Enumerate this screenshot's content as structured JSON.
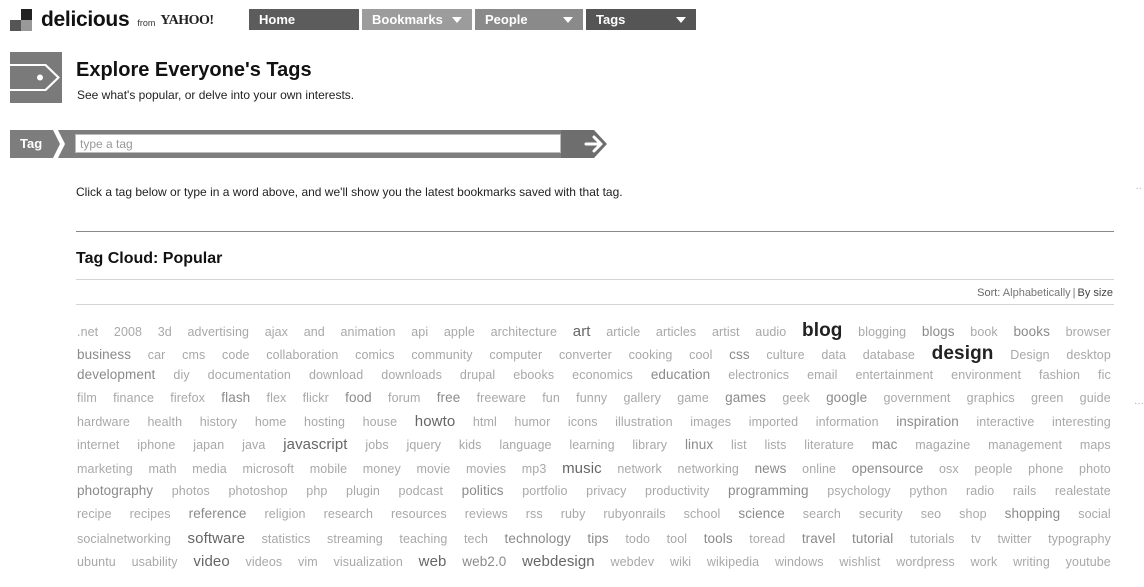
{
  "brand": {
    "name": "delicious",
    "from": "from",
    "yahoo": "YAHOO!"
  },
  "nav": {
    "home": "Home",
    "bookmarks": "Bookmarks",
    "people": "People",
    "tags": "Tags"
  },
  "header": {
    "title": "Explore Everyone's Tags",
    "subtitle": "See what's popular, or delve into your own interests."
  },
  "search": {
    "label": "Tag",
    "placeholder": "type a tag"
  },
  "instructions": "Click a tag below or type in a word above, and we'll show you the latest bookmarks saved with that tag.",
  "cloud": {
    "title": "Tag Cloud: Popular",
    "sort_label": "Sort:",
    "sort_alpha": "Alphabetically",
    "sort_separator": "|",
    "sort_size": "By size",
    "rows": [
      [
        [
          ".net",
          1
        ],
        [
          "2008",
          1
        ],
        [
          "3d",
          1
        ],
        [
          "advertising",
          1
        ],
        [
          "ajax",
          1
        ],
        [
          "and",
          1
        ],
        [
          "animation",
          1
        ],
        [
          "api",
          1
        ],
        [
          "apple",
          1
        ],
        [
          "architecture",
          1
        ],
        [
          "art",
          3
        ],
        [
          "article",
          1
        ],
        [
          "articles",
          1
        ],
        [
          "artist",
          1
        ],
        [
          "audio",
          1
        ],
        [
          "blog",
          5
        ],
        [
          "blogging",
          1
        ],
        [
          "blogs",
          2
        ],
        [
          "book",
          1
        ],
        [
          "books",
          2
        ],
        [
          "browser",
          1
        ]
      ],
      [
        [
          "business",
          2
        ],
        [
          "car",
          1
        ],
        [
          "cms",
          1
        ],
        [
          "code",
          1
        ],
        [
          "collaboration",
          1
        ],
        [
          "comics",
          1
        ],
        [
          "community",
          1
        ],
        [
          "computer",
          1
        ],
        [
          "converter",
          1
        ],
        [
          "cooking",
          1
        ],
        [
          "cool",
          1
        ],
        [
          "css",
          2
        ],
        [
          "culture",
          1
        ],
        [
          "data",
          1
        ],
        [
          "database",
          1
        ],
        [
          "design",
          5
        ],
        [
          "Design",
          1
        ],
        [
          "desktop",
          1
        ]
      ],
      [
        [
          "development",
          2
        ],
        [
          "diy",
          1
        ],
        [
          "documentation",
          1
        ],
        [
          "download",
          1
        ],
        [
          "downloads",
          1
        ],
        [
          "drupal",
          1
        ],
        [
          "ebooks",
          1
        ],
        [
          "economics",
          1
        ],
        [
          "education",
          2
        ],
        [
          "electronics",
          1
        ],
        [
          "email",
          1
        ],
        [
          "entertainment",
          1
        ],
        [
          "environment",
          1
        ],
        [
          "fashion",
          1
        ],
        [
          "fic",
          1
        ]
      ],
      [
        [
          "film",
          1
        ],
        [
          "finance",
          1
        ],
        [
          "firefox",
          1
        ],
        [
          "flash",
          2
        ],
        [
          "flex",
          1
        ],
        [
          "flickr",
          1
        ],
        [
          "food",
          2
        ],
        [
          "forum",
          1
        ],
        [
          "free",
          2
        ],
        [
          "freeware",
          1
        ],
        [
          "fun",
          1
        ],
        [
          "funny",
          1
        ],
        [
          "gallery",
          1
        ],
        [
          "game",
          1
        ],
        [
          "games",
          2
        ],
        [
          "geek",
          1
        ],
        [
          "google",
          2
        ],
        [
          "government",
          1
        ],
        [
          "graphics",
          1
        ],
        [
          "green",
          1
        ],
        [
          "guide",
          1
        ]
      ],
      [
        [
          "hardware",
          1
        ],
        [
          "health",
          1
        ],
        [
          "history",
          1
        ],
        [
          "home",
          1
        ],
        [
          "hosting",
          1
        ],
        [
          "house",
          1
        ],
        [
          "howto",
          3
        ],
        [
          "html",
          1
        ],
        [
          "humor",
          1
        ],
        [
          "icons",
          1
        ],
        [
          "illustration",
          1
        ],
        [
          "images",
          1
        ],
        [
          "imported",
          1
        ],
        [
          "information",
          1
        ],
        [
          "inspiration",
          2
        ],
        [
          "interactive",
          1
        ],
        [
          "interesting",
          1
        ]
      ],
      [
        [
          "internet",
          1
        ],
        [
          "iphone",
          1
        ],
        [
          "japan",
          1
        ],
        [
          "java",
          1
        ],
        [
          "javascript",
          3
        ],
        [
          "jobs",
          1
        ],
        [
          "jquery",
          1
        ],
        [
          "kids",
          1
        ],
        [
          "language",
          1
        ],
        [
          "learning",
          1
        ],
        [
          "library",
          1
        ],
        [
          "linux",
          2
        ],
        [
          "list",
          1
        ],
        [
          "lists",
          1
        ],
        [
          "literature",
          1
        ],
        [
          "mac",
          2
        ],
        [
          "magazine",
          1
        ],
        [
          "management",
          1
        ],
        [
          "maps",
          1
        ]
      ],
      [
        [
          "marketing",
          1
        ],
        [
          "math",
          1
        ],
        [
          "media",
          1
        ],
        [
          "microsoft",
          1
        ],
        [
          "mobile",
          1
        ],
        [
          "money",
          1
        ],
        [
          "movie",
          1
        ],
        [
          "movies",
          1
        ],
        [
          "mp3",
          1
        ],
        [
          "music",
          3
        ],
        [
          "network",
          1
        ],
        [
          "networking",
          1
        ],
        [
          "news",
          2
        ],
        [
          "online",
          1
        ],
        [
          "opensource",
          2
        ],
        [
          "osx",
          1
        ],
        [
          "people",
          1
        ],
        [
          "phone",
          1
        ],
        [
          "photo",
          1
        ]
      ],
      [
        [
          "photography",
          2
        ],
        [
          "photos",
          1
        ],
        [
          "photoshop",
          1
        ],
        [
          "php",
          1
        ],
        [
          "plugin",
          1
        ],
        [
          "podcast",
          1
        ],
        [
          "politics",
          2
        ],
        [
          "portfolio",
          1
        ],
        [
          "privacy",
          1
        ],
        [
          "productivity",
          1
        ],
        [
          "programming",
          2
        ],
        [
          "psychology",
          1
        ],
        [
          "python",
          1
        ],
        [
          "radio",
          1
        ],
        [
          "rails",
          1
        ],
        [
          "realestate",
          1
        ]
      ],
      [
        [
          "recipe",
          1
        ],
        [
          "recipes",
          1
        ],
        [
          "reference",
          2
        ],
        [
          "religion",
          1
        ],
        [
          "research",
          1
        ],
        [
          "resources",
          1
        ],
        [
          "reviews",
          1
        ],
        [
          "rss",
          1
        ],
        [
          "ruby",
          1
        ],
        [
          "rubyonrails",
          1
        ],
        [
          "school",
          1
        ],
        [
          "science",
          2
        ],
        [
          "search",
          1
        ],
        [
          "security",
          1
        ],
        [
          "seo",
          1
        ],
        [
          "shop",
          1
        ],
        [
          "shopping",
          2
        ],
        [
          "social",
          1
        ]
      ],
      [
        [
          "socialnetworking",
          1
        ],
        [
          "software",
          3
        ],
        [
          "statistics",
          1
        ],
        [
          "streaming",
          1
        ],
        [
          "teaching",
          1
        ],
        [
          "tech",
          1
        ],
        [
          "technology",
          2
        ],
        [
          "tips",
          2
        ],
        [
          "todo",
          1
        ],
        [
          "tool",
          1
        ],
        [
          "tools",
          2
        ],
        [
          "toread",
          1
        ],
        [
          "travel",
          2
        ],
        [
          "tutorial",
          2
        ],
        [
          "tutorials",
          1
        ],
        [
          "tv",
          1
        ],
        [
          "twitter",
          1
        ],
        [
          "typography",
          1
        ]
      ],
      [
        [
          "ubuntu",
          1
        ],
        [
          "usability",
          1
        ],
        [
          "video",
          3
        ],
        [
          "videos",
          1
        ],
        [
          "vim",
          1
        ],
        [
          "visualization",
          1
        ],
        [
          "web",
          3
        ],
        [
          "web2.0",
          2
        ],
        [
          "webdesign",
          3
        ],
        [
          "webdev",
          1
        ],
        [
          "wiki",
          1
        ],
        [
          "wikipedia",
          1
        ],
        [
          "windows",
          1
        ],
        [
          "wishlist",
          1
        ],
        [
          "wordpress",
          1
        ],
        [
          "work",
          1
        ],
        [
          "writing",
          1
        ],
        [
          "youtube",
          1
        ]
      ]
    ]
  }
}
